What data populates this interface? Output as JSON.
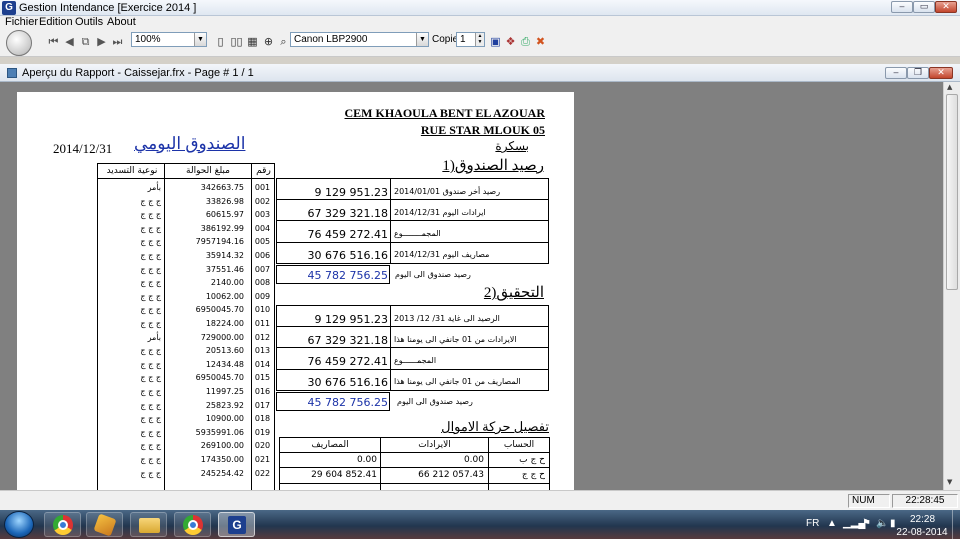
{
  "window": {
    "title": "Gestion Intendance [Exercice  2014 ]"
  },
  "menu": [
    "Fichier",
    "Edition",
    "Outils",
    "About"
  ],
  "toolbar": {
    "zoom": "100%",
    "printer": "Canon LBP2900",
    "copies_label": "Copies",
    "copies_value": "1"
  },
  "child_window": {
    "title": "Aperçu du Rapport - Caissejar.frx - Page # 1 / 1"
  },
  "report": {
    "school": "CEM KHAOULA BENT  EL AZOUAR",
    "street": "RUE STAR MLOUK 05",
    "city": "بسكرة",
    "title": "الصندوق اليومي",
    "date": "2014/12/31",
    "section1": "1)رصيد الصندوق",
    "section2": "2)التحقيق",
    "section3": "تفصيل حركة الاموال",
    "left_table": {
      "headers": [
        "نوعية التسديد",
        "مبلغ الحوالة",
        "رقم"
      ],
      "rows": [
        [
          "بأمر",
          "342663.75",
          "001"
        ],
        [
          "ج ج ج",
          "33826.98",
          "002"
        ],
        [
          "ج ج ج",
          "60615.97",
          "003"
        ],
        [
          "ج ج ج",
          "386192.99",
          "004"
        ],
        [
          "ج ج ج",
          "7957194.16",
          "005"
        ],
        [
          "ج ج ج",
          "35914.32",
          "006"
        ],
        [
          "ج ج ج",
          "37551.46",
          "007"
        ],
        [
          "ج ج ج",
          "2140.00",
          "008"
        ],
        [
          "ج ج ج",
          "10062.00",
          "009"
        ],
        [
          "ج ج ج",
          "6950045.70",
          "010"
        ],
        [
          "ج ج ج",
          "18224.00",
          "011"
        ],
        [
          "بأمر",
          "729000.00",
          "012"
        ],
        [
          "ج ج ج",
          "20513.60",
          "013"
        ],
        [
          "ج ج ج",
          "12434.48",
          "014"
        ],
        [
          "ج ج ج",
          "6950045.70",
          "015"
        ],
        [
          "ج ج ج",
          "11997.25",
          "016"
        ],
        [
          "ج ج ج",
          "25823.92",
          "017"
        ],
        [
          "ج ج ج",
          "10900.00",
          "018"
        ],
        [
          "ج ج ج",
          "5935991.06",
          "019"
        ],
        [
          "ج ج ج",
          "269100.00",
          "020"
        ],
        [
          "ج ج ج",
          "174350.00",
          "021"
        ],
        [
          "ج ج ج",
          "245254.42",
          "022"
        ]
      ]
    },
    "balance": {
      "rows": [
        {
          "label": "رصيد أخر صندوق 2014/01/01",
          "value": "9 129 951.23"
        },
        {
          "label": "ايرادات اليوم 2014/12/31",
          "value": "67 329 321.18"
        },
        {
          "label": "المجمــــــــوع",
          "value": "76 459 272.41"
        },
        {
          "label": "مصاريف اليوم 2014/12/31",
          "value": "30 676 516.16"
        }
      ],
      "result_label": "رصيد صندوق الى اليوم",
      "result_value": "45 782 756.25"
    },
    "verification": {
      "rows": [
        {
          "label": "الرصيد الى غاية 31/ 12/ 2013",
          "value": "9 129 951.23"
        },
        {
          "label": "الايرادات من 01 جانفي الى يومنا هذا",
          "value": "67 329 321.18"
        },
        {
          "label": "المجمــــــوع",
          "value": "76 459 272.41"
        },
        {
          "label": "المصاريف من 01 جانفي الى يومنا هذا",
          "value": "30 676 516.16"
        }
      ],
      "result_label": "رصيد صندوق الى اليوم",
      "result_value": "45 782 756.25"
    },
    "movement": {
      "headers": [
        "الحساب",
        "الايرادات",
        "المصاريف"
      ],
      "rows": [
        {
          "account": "ح ج ب",
          "revenue": "0.00",
          "expense": "0.00"
        },
        {
          "account": "ح ج ج",
          "revenue": "66 212 057.43",
          "expense": "29 604 852.41"
        }
      ]
    }
  },
  "status": {
    "num": "NUM",
    "time": "22:28:45"
  },
  "taskbar": {
    "lang": "FR",
    "clock_time": "22:28",
    "clock_date": "22-08-2014"
  },
  "colors": {
    "accent_blue": "#1c33a8",
    "preview_bg": "#808080"
  }
}
